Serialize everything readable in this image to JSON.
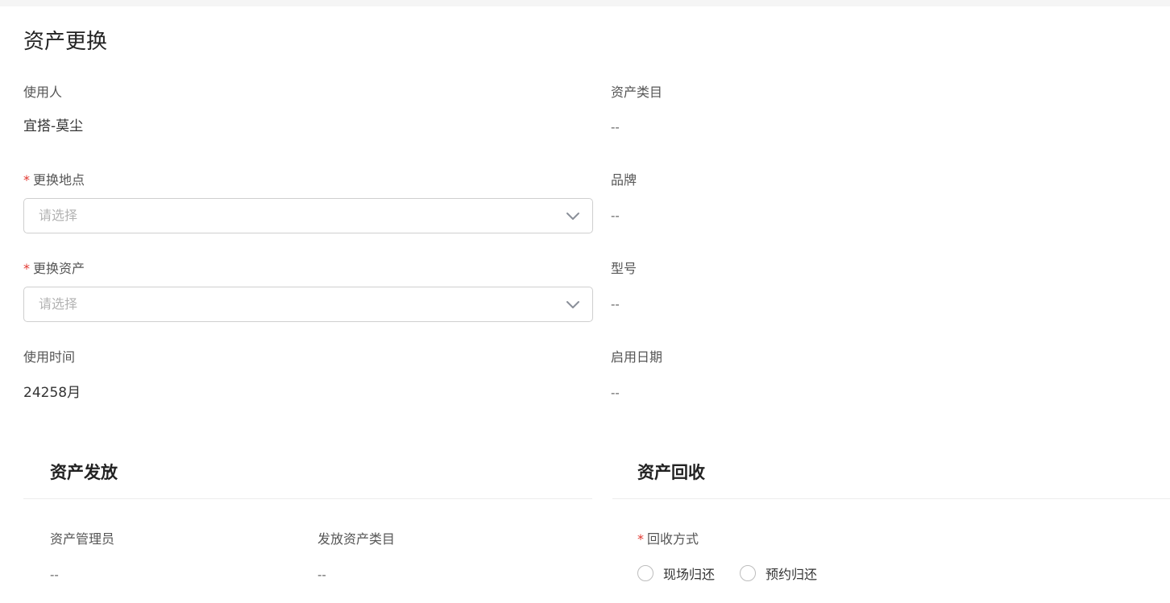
{
  "page": {
    "title": "资产更换"
  },
  "form": {
    "user": {
      "label": "使用人",
      "value": "宜搭-莫尘"
    },
    "category": {
      "label": "资产类目",
      "value": "--"
    },
    "location": {
      "label": "更换地点",
      "required_mark": "*",
      "placeholder": "请选择"
    },
    "brand": {
      "label": "品牌",
      "value": "--"
    },
    "asset": {
      "label": "更换资产",
      "required_mark": "*",
      "placeholder": "请选择"
    },
    "model": {
      "label": "型号",
      "value": "--"
    },
    "usage_time": {
      "label": "使用时间",
      "value": "24258月"
    },
    "start_date": {
      "label": "启用日期",
      "value": "--"
    }
  },
  "issue_section": {
    "title": "资产发放",
    "manager": {
      "label": "资产管理员",
      "value": "--"
    },
    "issue_category": {
      "label": "发放资产类目",
      "value": "--"
    }
  },
  "recycle_section": {
    "title": "资产回收",
    "method": {
      "label": "回收方式",
      "required_mark": "*",
      "options": [
        "现场归还",
        "预约归还"
      ],
      "selected": null
    }
  },
  "colors": {
    "required": "#e2372f",
    "border": "#cfcfcf",
    "placeholder": "#b3b3b3"
  },
  "icons": {
    "select_arrow": "chevron-down-icon"
  }
}
